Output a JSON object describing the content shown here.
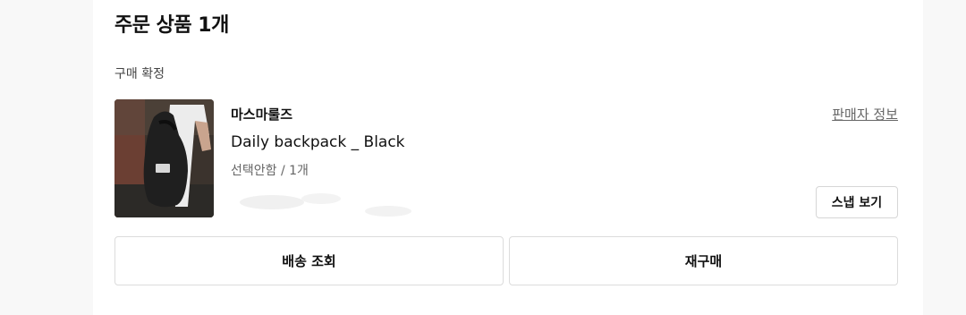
{
  "section": {
    "title": "주문 상품 1개",
    "status": "구매 확정"
  },
  "item": {
    "brand": "마스마룰즈",
    "product_name": "Daily backpack _ Black",
    "option": "선택안함 / 1개",
    "seller_info_label": "판매자 정보",
    "snap_label": "스냅 보기"
  },
  "actions": {
    "track_shipping": "배송 조회",
    "reorder": "재구매"
  }
}
